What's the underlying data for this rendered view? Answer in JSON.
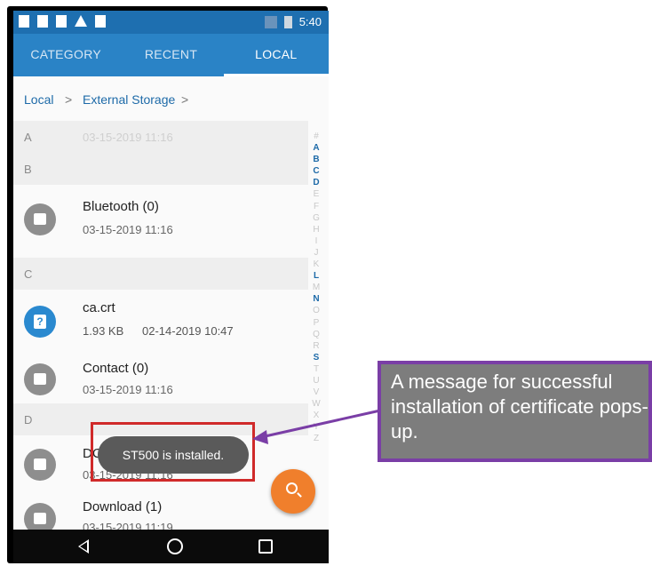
{
  "status_bar": {
    "time": "5:40"
  },
  "tabs": [
    {
      "label": "CATEGORY",
      "active": false
    },
    {
      "label": "RECENT",
      "active": false
    },
    {
      "label": "LOCAL",
      "active": true
    }
  ],
  "breadcrumb": {
    "root": "Local",
    "sep1": ">",
    "folder": "External Storage",
    "sep2": ">"
  },
  "sections": {
    "a": "A",
    "b": "B",
    "c": "C",
    "d": "D"
  },
  "files": {
    "first_faded_date": "03-15-2019 11:16",
    "bluetooth": {
      "name": "Bluetooth (0)",
      "date": "03-15-2019 11:16"
    },
    "ca_crt": {
      "name": "ca.crt",
      "size": "1.93 KB",
      "date": "02-14-2019 10:47"
    },
    "contact": {
      "name": "Contact (0)",
      "date": "03-15-2019 11:16"
    },
    "dcim": {
      "name": "DCIM (0)",
      "date": "03-15-2019 11:16"
    },
    "download": {
      "name": "Download (1)",
      "date": "03-15-2019 11:19"
    }
  },
  "alphabet_index": [
    "#",
    "A",
    "B",
    "C",
    "D",
    "E",
    "F",
    "G",
    "H",
    "I",
    "J",
    "K",
    "L",
    "M",
    "N",
    "O",
    "P",
    "Q",
    "R",
    "S",
    "T",
    "U",
    "V",
    "W",
    "X",
    "Y",
    "Z"
  ],
  "alphabet_highlighted": [
    "A",
    "B",
    "C",
    "D",
    "L",
    "N",
    "S"
  ],
  "toast": {
    "message": "ST500 is installed."
  },
  "callout": {
    "text": "A message for successful installation of certificate pops-up."
  },
  "colors": {
    "tab_bar": "#2a83c6",
    "status_bar": "#1e6fb0",
    "fab": "#f07f2c",
    "callout_border": "#7a3ea6",
    "highlight_box": "#d02a2a"
  },
  "icons": [
    "folder-icon",
    "unknown-file-icon",
    "search-icon",
    "back-icon",
    "home-icon",
    "recents-icon"
  ]
}
